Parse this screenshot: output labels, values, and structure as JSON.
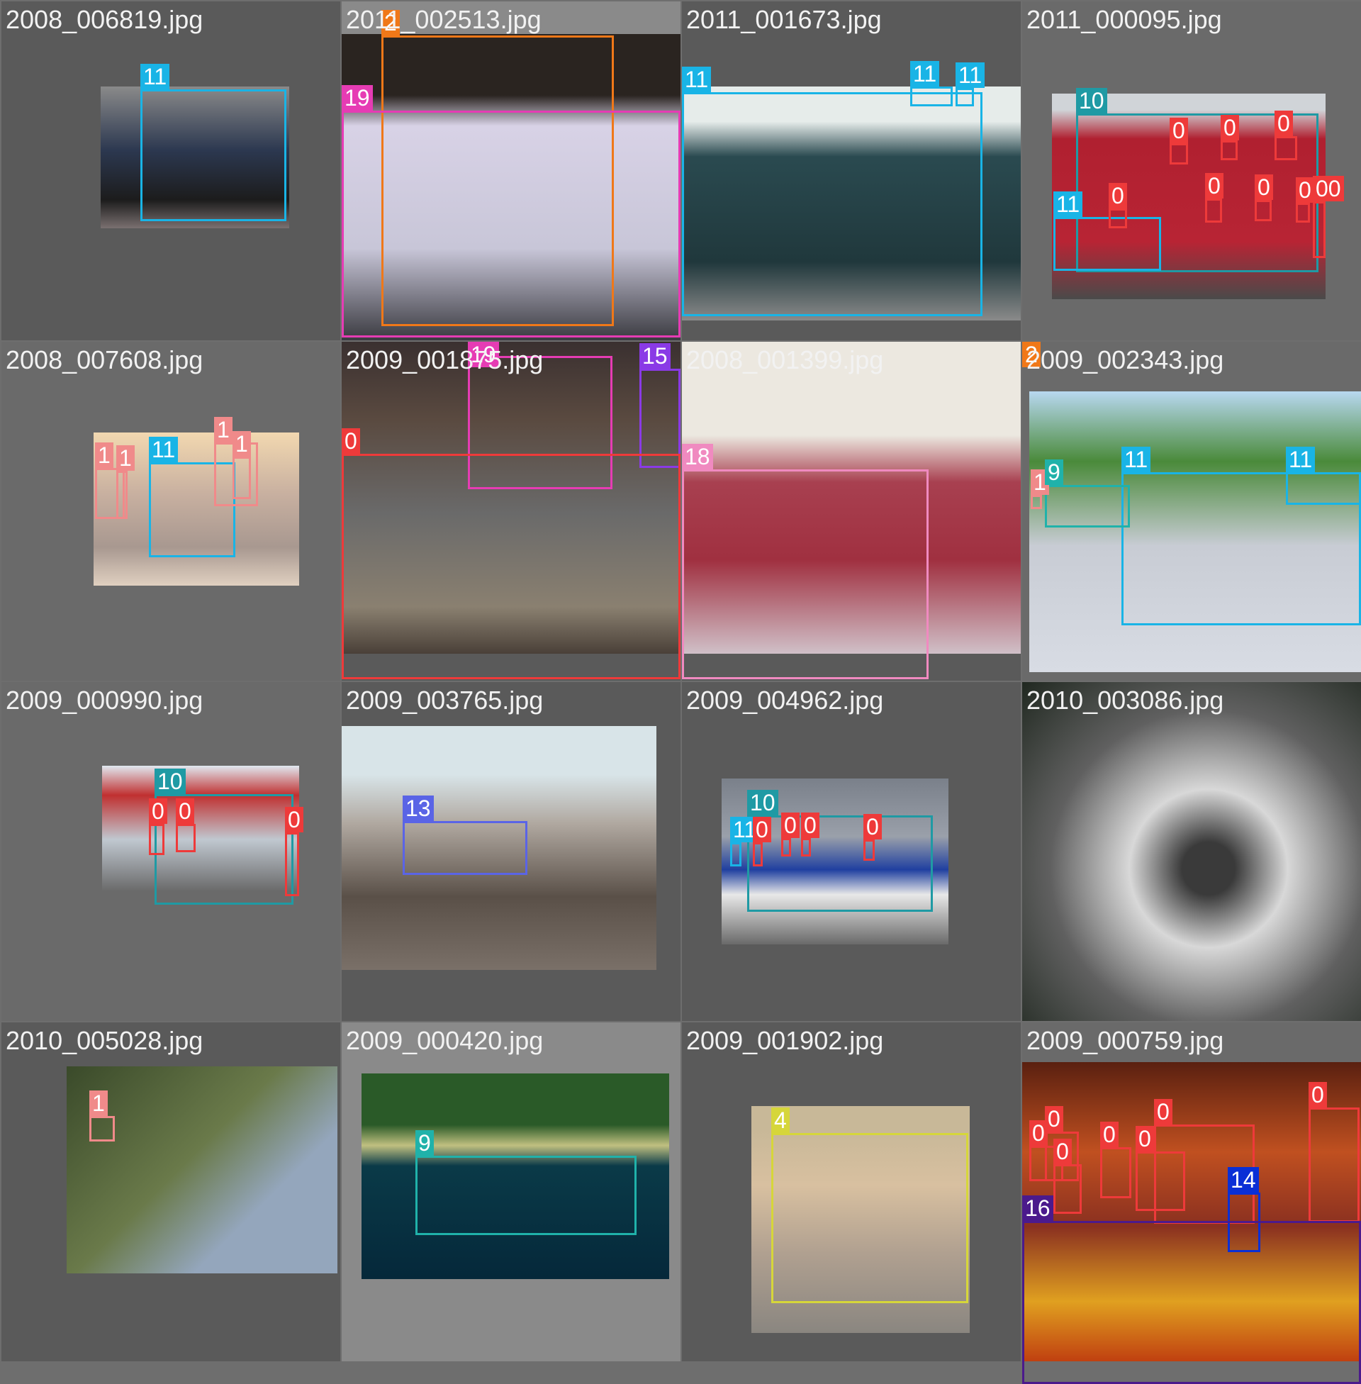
{
  "class_colors": {
    "0": "#ee3a3a",
    "1": "#f08a8a",
    "2": "#f07818",
    "4": "#d6d63a",
    "9": "#20b2aa",
    "10": "#1f9aa4",
    "11": "#19b4e6",
    "13": "#5a64e6",
    "14": "#0a2fd6",
    "15": "#8a3ae6",
    "16": "#4b1a8c",
    "18": "#f08ac0",
    "19": "#e63cb4"
  },
  "tiles": [
    {
      "filename": "2008_006819.jpg",
      "boxes": [
        {
          "cls": "11"
        }
      ]
    },
    {
      "filename": "2011_002513.jpg",
      "boxes": [
        {
          "cls": "2"
        },
        {
          "cls": "19"
        }
      ]
    },
    {
      "filename": "2011_001673.jpg",
      "boxes": [
        {
          "cls": "11"
        },
        {
          "cls": "11"
        },
        {
          "cls": "11"
        }
      ]
    },
    {
      "filename": "2011_000095.jpg",
      "boxes": [
        {
          "cls": "10"
        },
        {
          "cls": "0"
        },
        {
          "cls": "0"
        },
        {
          "cls": "0"
        },
        {
          "cls": "11"
        },
        {
          "cls": "0"
        },
        {
          "cls": "0"
        },
        {
          "cls": "0"
        },
        {
          "cls": "0"
        },
        {
          "cls": "00"
        }
      ]
    },
    {
      "filename": "2008_007608.jpg",
      "boxes": [
        {
          "cls": "1"
        },
        {
          "cls": "1"
        },
        {
          "cls": "11"
        },
        {
          "cls": "1"
        },
        {
          "cls": "1"
        }
      ]
    },
    {
      "filename": "2009_001875.jpg",
      "boxes": [
        {
          "cls": "19"
        },
        {
          "cls": "15"
        },
        {
          "cls": "0"
        }
      ]
    },
    {
      "filename": "2008_001399.jpg",
      "boxes": [
        {
          "cls": "18"
        }
      ]
    },
    {
      "filename": "2009_002343.jpg",
      "boxes": [
        {
          "cls": "11"
        },
        {
          "cls": "1"
        },
        {
          "cls": "9"
        },
        {
          "cls": "11"
        },
        {
          "cls": "2"
        }
      ]
    },
    {
      "filename": "2009_000990.jpg",
      "boxes": [
        {
          "cls": "10"
        },
        {
          "cls": "0"
        },
        {
          "cls": "0"
        },
        {
          "cls": "0"
        }
      ]
    },
    {
      "filename": "2009_003765.jpg",
      "boxes": [
        {
          "cls": "13"
        }
      ]
    },
    {
      "filename": "2009_004962.jpg",
      "boxes": [
        {
          "cls": "10"
        },
        {
          "cls": "11"
        },
        {
          "cls": "0"
        },
        {
          "cls": "0"
        },
        {
          "cls": "0"
        },
        {
          "cls": "0"
        }
      ]
    },
    {
      "filename": "2010_003086.jpg",
      "boxes": []
    },
    {
      "filename": "2010_005028.jpg",
      "boxes": [
        {
          "cls": "1"
        }
      ]
    },
    {
      "filename": "2009_000420.jpg",
      "boxes": [
        {
          "cls": "9"
        }
      ]
    },
    {
      "filename": "2009_001902.jpg",
      "boxes": [
        {
          "cls": "4"
        }
      ]
    },
    {
      "filename": "2009_000759.jpg",
      "boxes": [
        {
          "cls": "0"
        },
        {
          "cls": "0"
        },
        {
          "cls": "0"
        },
        {
          "cls": "0"
        },
        {
          "cls": "0"
        },
        {
          "cls": "0"
        },
        {
          "cls": "0"
        },
        {
          "cls": "14"
        },
        {
          "cls": "16"
        }
      ]
    }
  ]
}
